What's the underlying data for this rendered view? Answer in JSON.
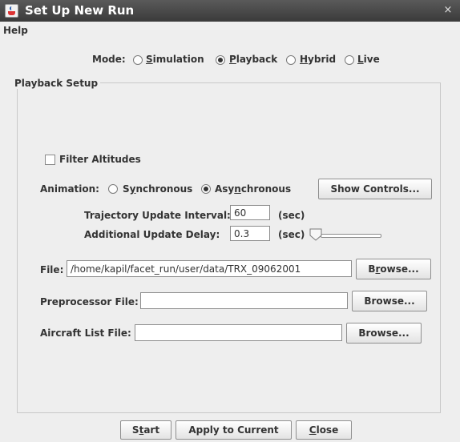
{
  "window": {
    "title": "Set Up New Run",
    "close_glyph": "×"
  },
  "menu": {
    "help": "Help"
  },
  "mode": {
    "label": "Mode:",
    "options": [
      {
        "label": "Simulation",
        "mnemonic": "S",
        "rest": "imulation",
        "selected": false
      },
      {
        "label": "Playback",
        "mnemonic": "P",
        "rest": "layback",
        "selected": true
      },
      {
        "label": "Hybrid",
        "mnemonic": "H",
        "rest": "ybrid",
        "selected": false
      },
      {
        "label": "Live",
        "mnemonic": "L",
        "rest": "ive",
        "selected": false
      }
    ]
  },
  "group": {
    "title": "Playback Setup"
  },
  "filter": {
    "label": "Filter Altitudes",
    "checked": false
  },
  "animation": {
    "label": "Animation:",
    "synchronous": {
      "pre": "S",
      "mnemonic": "y",
      "rest": "nchronous",
      "selected": false
    },
    "asynchronous": {
      "pre": "Asy",
      "mnemonic": "n",
      "rest": "chronous",
      "selected": true
    },
    "show_controls": "Show Controls..."
  },
  "trajectory": {
    "label": "Trajectory Update Interval:",
    "value": "60",
    "unit": "(sec)"
  },
  "delay": {
    "label": "Additional Update Delay:",
    "value": "0.3",
    "unit": "(sec)"
  },
  "file": {
    "label": "File:",
    "value": "/home/kapil/facet_run/user/data/TRX_09062001",
    "browse_pre": "B",
    "browse_mnemonic": "r",
    "browse_rest": "owse..."
  },
  "preprocessor": {
    "label": "Preprocessor File:",
    "value": "",
    "browse": "Browse..."
  },
  "aircraft": {
    "label": "Aircraft List File:",
    "value": "",
    "browse": "Browse..."
  },
  "footer": {
    "start_pre": "S",
    "start_mnemonic": "t",
    "start_rest": "art",
    "apply": "Apply to Current",
    "close_mnemonic": "C",
    "close_rest": "lose"
  },
  "colors": {
    "titlebar": "#4a4a4a",
    "background": "#eeeeee",
    "text": "#333333"
  },
  "icons": {
    "app": "java-cup-icon",
    "close": "close-icon"
  }
}
